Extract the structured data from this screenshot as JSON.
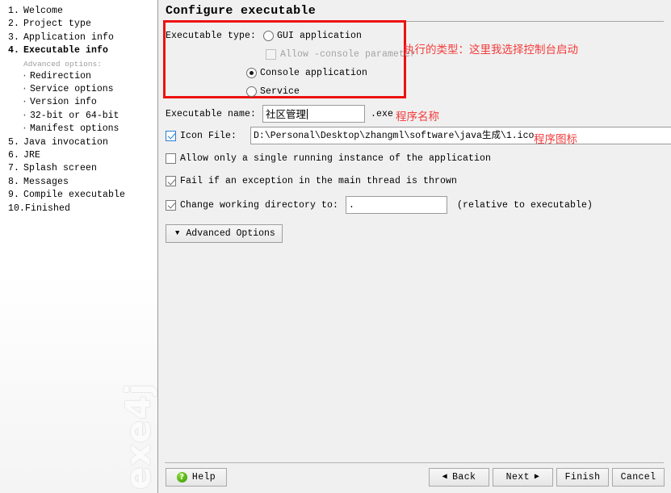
{
  "sidebar": {
    "steps": [
      {
        "num": "1.",
        "label": "Welcome",
        "current": false
      },
      {
        "num": "2.",
        "label": "Project type",
        "current": false
      },
      {
        "num": "3.",
        "label": "Application info",
        "current": false
      },
      {
        "num": "4.",
        "label": "Executable info",
        "current": true
      }
    ],
    "advanced_heading": "Advanced options:",
    "advanced_items": [
      {
        "label": "Redirection"
      },
      {
        "label": "Service options"
      },
      {
        "label": "Version info"
      },
      {
        "label": "32-bit or 64-bit"
      },
      {
        "label": "Manifest options"
      }
    ],
    "steps_after": [
      {
        "num": "5.",
        "label": "Java invocation",
        "current": false
      },
      {
        "num": "6.",
        "label": "JRE",
        "current": false
      },
      {
        "num": "7.",
        "label": "Splash screen",
        "current": false
      },
      {
        "num": "8.",
        "label": "Messages",
        "current": false
      },
      {
        "num": "9.",
        "label": "Compile executable",
        "current": false
      },
      {
        "num": "10.",
        "label": "Finished",
        "current": false
      }
    ],
    "watermark": "exe4j"
  },
  "main": {
    "page_title": "Configure executable",
    "executable_type": {
      "label": "Executable type:",
      "options": [
        {
          "label": "GUI application",
          "selected": false,
          "disabled": false
        },
        {
          "label": "Console application",
          "selected": true,
          "disabled": false
        },
        {
          "label": "Service",
          "selected": false,
          "disabled": false
        }
      ],
      "allow_console": {
        "label": "Allow -console parameter",
        "checked": false,
        "disabled": true
      }
    },
    "executable_name": {
      "label": "Executable name:",
      "value": "社区管理",
      "suffix": ".exe"
    },
    "icon_file": {
      "label": "Icon File:",
      "checked": true,
      "value": "D:\\Personal\\Desktop\\zhangml\\software\\java生成\\1.ico",
      "browse_label": "..."
    },
    "single_instance": {
      "label": "Allow only a single running instance of the application",
      "checked": false
    },
    "fail_on_exception": {
      "label": "Fail if an exception in the main thread is thrown",
      "checked": true
    },
    "working_directory": {
      "label": "Change working directory to:",
      "value": ".",
      "hint": "(relative to executable)",
      "checked": true
    },
    "advanced_options_button": "Advanced Options",
    "annotations": [
      {
        "text": "执行的类型：这里我选择控制台启动",
        "name": "annotation-executable-type"
      },
      {
        "text": "程序名称",
        "name": "annotation-program-name"
      },
      {
        "text": "程序图标",
        "name": "annotation-program-icon"
      }
    ]
  },
  "footer": {
    "help": "Help",
    "back": "Back",
    "next": "Next",
    "finish": "Finish",
    "cancel": "Cancel",
    "back_arrow": "◀",
    "next_arrow": "▶",
    "help_glyph": "?"
  },
  "colors": {
    "annotation_red": "#f43c3c",
    "highlight_box": "#ee1111",
    "panel_bg": "#f0f0f0"
  }
}
